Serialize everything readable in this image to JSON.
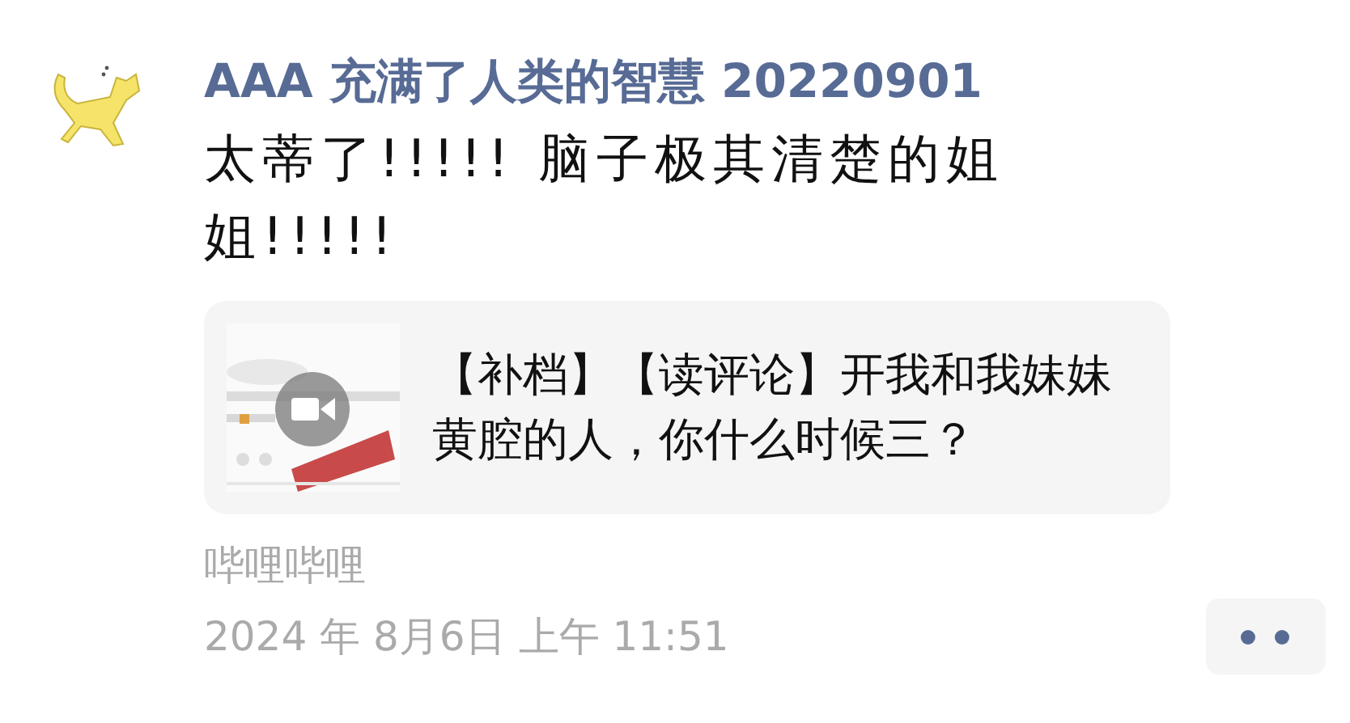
{
  "post": {
    "author": "AAA 充满了人类的智慧 20220901",
    "text": "太蒂了!!!!! 脑子极其清楚的姐姐!!!!!",
    "link": {
      "thumbnail": {
        "kind": "picture",
        "video": true
      },
      "title": "【补档】【读评论】开我和我妹妹黄腔的人，你什么时候三？"
    },
    "source": "哔哩哔哩",
    "time": "2024 年 8月6日 上午 11:51"
  }
}
